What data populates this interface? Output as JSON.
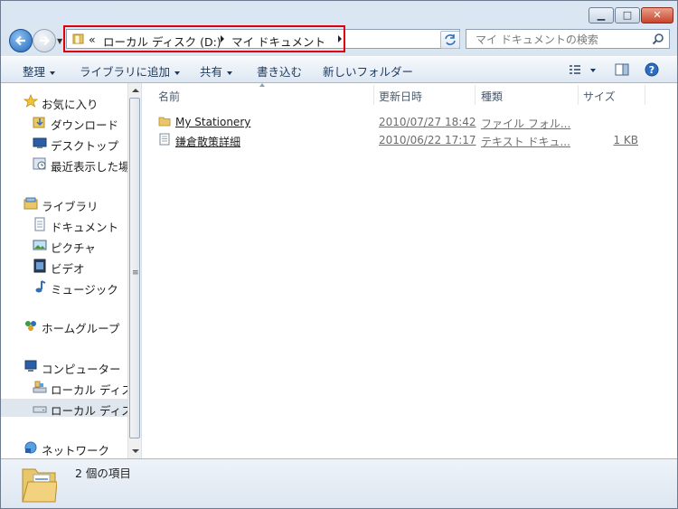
{
  "window": {
    "minimize_icon": "minimize-icon",
    "maximize_icon": "maximize-icon",
    "close_icon": "close-icon"
  },
  "address_bar": {
    "overflow": "«",
    "crumbs": [
      "ローカル ディスク (D:)",
      "マイ ドキュメント"
    ],
    "highlight_color": "#e0000d"
  },
  "search": {
    "placeholder": "マイ ドキュメントの検索"
  },
  "toolbar": {
    "organize": "整理",
    "add_to_library": "ライブラリに追加",
    "share": "共有",
    "burn": "書き込む",
    "new_folder": "新しいフォルダー"
  },
  "navigation": {
    "favorites": "お気に入り",
    "downloads": "ダウンロード",
    "desktop": "デスクトップ",
    "recent": "最近表示した場所",
    "libraries": "ライブラリ",
    "documents": "ドキュメント",
    "pictures": "ピクチャ",
    "videos": "ビデオ",
    "music": "ミュージック",
    "homegroup": "ホームグループ",
    "computer": "コンピューター",
    "local_disk_c": "ローカル ディスク",
    "local_disk_d": "ローカル ディスク",
    "network": "ネットワーク"
  },
  "columns": {
    "name": "名前",
    "date": "更新日時",
    "type": "種類",
    "size": "サイズ"
  },
  "files": [
    {
      "name": "My Stationery",
      "date": "2010/07/27 18:42",
      "type": "ファイル フォル...",
      "size": "",
      "icon": "folder-icon"
    },
    {
      "name": "鎌倉散策詳細",
      "date": "2010/06/22 17:17",
      "type": "テキスト ドキュ...",
      "size": "1 KB",
      "icon": "text-file-icon"
    }
  ],
  "details": {
    "count": "2 個の項目"
  }
}
